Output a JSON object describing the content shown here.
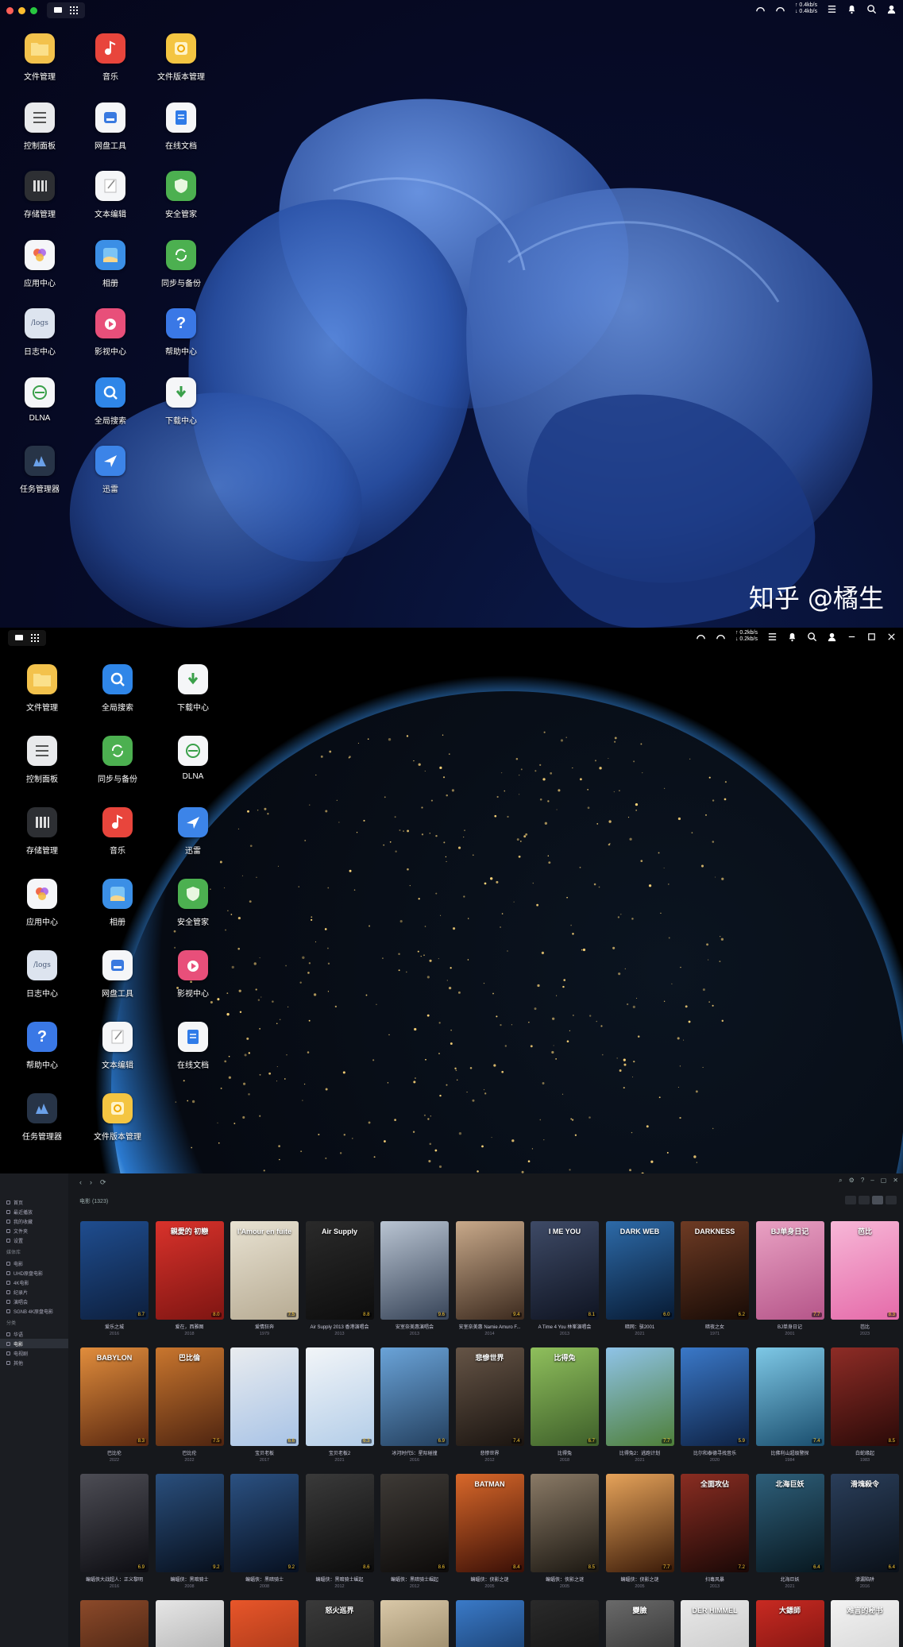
{
  "desktop1": {
    "speed": {
      "up": "↑ 0.4kb/s",
      "down": "↓ 0.4kb/s"
    },
    "apps": [
      {
        "label": "文件管理",
        "icon": "folder-icon",
        "color": "#f3c24c"
      },
      {
        "label": "音乐",
        "icon": "music-icon",
        "color": "#e8453c"
      },
      {
        "label": "文件版本管理",
        "icon": "version-icon",
        "color": "#f4c542"
      },
      {
        "label": "控制面板",
        "icon": "control-panel-icon",
        "color": "#e9eaec"
      },
      {
        "label": "网盘工具",
        "icon": "cloud-drive-icon",
        "color": "#f5f6f8"
      },
      {
        "label": "在线文档",
        "icon": "document-icon",
        "color": "#f5f6f8"
      },
      {
        "label": "存储管理",
        "icon": "storage-icon",
        "color": "#2d2f33"
      },
      {
        "label": "文本编辑",
        "icon": "text-edit-icon",
        "color": "#f5f6f8"
      },
      {
        "label": "安全管家",
        "icon": "shield-icon",
        "color": "#4cb050"
      },
      {
        "label": "应用中心",
        "icon": "app-center-icon",
        "color": "#f5f6f8"
      },
      {
        "label": "相册",
        "icon": "photos-icon",
        "color": "#3b8fe6"
      },
      {
        "label": "同步与备份",
        "icon": "sync-icon",
        "color": "#4cb050"
      },
      {
        "label": "日志中心",
        "icon": "logs-icon",
        "color": "#dde4ef",
        "text": "/logs"
      },
      {
        "label": "影视中心",
        "icon": "video-icon",
        "color": "#e84f7a"
      },
      {
        "label": "帮助中心",
        "icon": "help-icon",
        "color": "#3a78e6"
      },
      {
        "label": "DLNA",
        "icon": "dlna-icon",
        "color": "#f5f6f8"
      },
      {
        "label": "全局搜索",
        "icon": "search-icon",
        "color": "#2f86e8"
      },
      {
        "label": "下载中心",
        "icon": "download-icon",
        "color": "#f5f6f8"
      },
      {
        "label": "任务管理器",
        "icon": "task-manager-icon",
        "color": "#273447"
      },
      {
        "label": "迅雷",
        "icon": "thunder-icon",
        "color": "#3c84e8"
      }
    ],
    "watermark": "知乎 @橘生"
  },
  "desktop2": {
    "speed": {
      "up": "↑ 0.2kb/s",
      "down": "↓ 0.2kb/s"
    },
    "apps": [
      {
        "label": "文件管理",
        "icon": "folder-icon",
        "color": "#f3c24c"
      },
      {
        "label": "全局搜索",
        "icon": "search-icon",
        "color": "#2f86e8"
      },
      {
        "label": "下载中心",
        "icon": "download-icon",
        "color": "#f5f6f8"
      },
      {
        "label": "控制面板",
        "icon": "control-panel-icon",
        "color": "#e9eaec"
      },
      {
        "label": "同步与备份",
        "icon": "sync-icon",
        "color": "#4cb050"
      },
      {
        "label": "DLNA",
        "icon": "dlna-icon",
        "color": "#f5f6f8"
      },
      {
        "label": "存储管理",
        "icon": "storage-icon",
        "color": "#2d2f33"
      },
      {
        "label": "音乐",
        "icon": "music-icon",
        "color": "#e8453c"
      },
      {
        "label": "迅雷",
        "icon": "thunder-icon",
        "color": "#3c84e8"
      },
      {
        "label": "应用中心",
        "icon": "app-center-icon",
        "color": "#f5f6f8"
      },
      {
        "label": "相册",
        "icon": "photos-icon",
        "color": "#3b8fe6"
      },
      {
        "label": "安全管家",
        "icon": "shield-icon",
        "color": "#4cb050"
      },
      {
        "label": "日志中心",
        "icon": "logs-icon",
        "color": "#dde4ef",
        "text": "/logs"
      },
      {
        "label": "网盘工具",
        "icon": "cloud-drive-icon",
        "color": "#f5f6f8"
      },
      {
        "label": "影视中心",
        "icon": "video-icon",
        "color": "#e84f7a"
      },
      {
        "label": "帮助中心",
        "icon": "help-icon",
        "color": "#3a78e6"
      },
      {
        "label": "文本编辑",
        "icon": "text-edit-icon",
        "color": "#f5f6f8"
      },
      {
        "label": "在线文档",
        "icon": "document-icon",
        "color": "#f5f6f8"
      },
      {
        "label": "任务管理器",
        "icon": "task-manager-icon",
        "color": "#273447"
      },
      {
        "label": "文件版本管理",
        "icon": "version-icon",
        "color": "#f4c542"
      }
    ]
  },
  "media": {
    "breadcrumb": "电影 (1323)",
    "sidebar": [
      {
        "type": "item",
        "label": "首页"
      },
      {
        "type": "item",
        "label": "最近播放"
      },
      {
        "type": "item",
        "label": "我的收藏"
      },
      {
        "type": "item",
        "label": "文件夹"
      },
      {
        "type": "item",
        "label": "设置"
      },
      {
        "type": "sec",
        "label": "媒体库"
      },
      {
        "type": "item",
        "label": "电影"
      },
      {
        "type": "item",
        "label": "UHD原盘电影"
      },
      {
        "type": "item",
        "label": "4K电影"
      },
      {
        "type": "item",
        "label": "纪录片"
      },
      {
        "type": "item",
        "label": "演唱会"
      },
      {
        "type": "item",
        "label": "SGNB 4K原盘电影"
      },
      {
        "type": "sec",
        "label": "分类"
      },
      {
        "type": "item",
        "label": "华语"
      },
      {
        "type": "item",
        "label": "电影",
        "active": true
      },
      {
        "type": "item",
        "label": "电视剧"
      },
      {
        "type": "item",
        "label": "其他"
      }
    ],
    "posters": [
      [
        {
          "t": "爱乐之城",
          "y": "2016",
          "c1": "#1f4d8f",
          "c2": "#0d1f3d",
          "p": "",
          "r": "8.7"
        },
        {
          "t": "爱在，西雅图",
          "y": "2018",
          "c1": "#d9322b",
          "c2": "#7e1512",
          "p": "親愛的 初戀",
          "r": "8.0"
        },
        {
          "t": "爱情狂奔",
          "y": "1979",
          "c1": "#e8e2d2",
          "c2": "#b7ab93",
          "p": "l'Amour en fuite",
          "r": "7.5"
        },
        {
          "t": "Air Supply 2013 香港演唱会",
          "y": "2013",
          "c1": "#2a2a2a",
          "c2": "#0d0d0d",
          "p": "Air Supply",
          "r": "8.8"
        },
        {
          "t": "安室奈美惠演唱会",
          "y": "2013",
          "c1": "#b9c4d2",
          "c2": "#374458",
          "p": "",
          "r": "9.6"
        },
        {
          "t": "安室奈美惠 Namie Amuro F...",
          "y": "2014",
          "c1": "#c8a98a",
          "c2": "#3c2a1e",
          "p": "",
          "r": "9.4"
        },
        {
          "t": "A Time 4 You 林峯演唱会",
          "y": "2013",
          "c1": "#3e4a66",
          "c2": "#0f1422",
          "p": "I ME YOU",
          "r": "8.1"
        },
        {
          "t": "暗网：骇2001",
          "y": "2021",
          "c1": "#2d6aa8",
          "c2": "#071a33",
          "p": "DARK WEB",
          "r": "6.0"
        },
        {
          "t": "暗夜之女",
          "y": "1971",
          "c1": "#6e3b24",
          "c2": "#180b06",
          "p": "DARKNESS",
          "r": "6.2"
        },
        {
          "t": "BJ单身日记",
          "y": "2001",
          "c1": "#e9a1c3",
          "c2": "#b55589",
          "p": "BJ单身日记",
          "r": "7.7"
        },
        {
          "t": "芭比",
          "y": "2023",
          "c1": "#f7b7d7",
          "c2": "#e56aa9",
          "p": "芭比",
          "r": "8.3"
        }
      ],
      [
        {
          "t": "巴比伦",
          "y": "2022",
          "c1": "#e18d3c",
          "c2": "#5a2810",
          "p": "BABYLON",
          "r": "8.3"
        },
        {
          "t": "巴比伦",
          "y": "2022",
          "c1": "#c9762e",
          "c2": "#4e2410",
          "p": "巴比倫",
          "r": "7.5"
        },
        {
          "t": "宝贝老板",
          "y": "2017",
          "c1": "#e9ecef",
          "c2": "#a8c3e6",
          "p": "",
          "r": "6.6"
        },
        {
          "t": "宝贝老板2",
          "y": "2021",
          "c1": "#f2f5f8",
          "c2": "#b3cde8",
          "p": "",
          "r": "6.3"
        },
        {
          "t": "冰河时代5：星际碰撞",
          "y": "2016",
          "c1": "#6aa3d8",
          "c2": "#24405f",
          "p": "",
          "r": "6.9"
        },
        {
          "t": "悲惨世界",
          "y": "2012",
          "c1": "#655446",
          "c2": "#1a1410",
          "p": "悲慘世界",
          "r": "7.4"
        },
        {
          "t": "比得兔",
          "y": "2018",
          "c1": "#8fbf5c",
          "c2": "#3e5f2a",
          "p": "比得兔",
          "r": "6.7"
        },
        {
          "t": "比得兔2：逃跑计划",
          "y": "2021",
          "c1": "#8fc3e8",
          "c2": "#4e7f38",
          "p": "",
          "r": "7.7"
        },
        {
          "t": "比尔和泰德寻找音乐",
          "y": "2020",
          "c1": "#3a78c8",
          "c2": "#0e2244",
          "p": "",
          "r": "5.9"
        },
        {
          "t": "比佛利山超级警探",
          "y": "1984",
          "c1": "#7ec8e6",
          "c2": "#1a4e6e",
          "p": "",
          "r": "7.4"
        },
        {
          "t": "白蛇缘起",
          "y": "1983",
          "c1": "#8e2c26",
          "c2": "#2a0a08",
          "p": "",
          "r": "8.5"
        }
      ],
      [
        {
          "t": "蝙蝠侠大战超人：正义黎明",
          "y": "2016",
          "c1": "#4d4d55",
          "c2": "#0d0d12",
          "p": "",
          "r": "6.9"
        },
        {
          "t": "蝙蝠侠：黑暗骑士",
          "y": "2008",
          "c1": "#2a4f7d",
          "c2": "#070f1c",
          "p": "",
          "r": "9.2"
        },
        {
          "t": "蝙蝠侠：黑暗骑士",
          "y": "2008",
          "c1": "#2b5182",
          "c2": "#071020",
          "p": "",
          "r": "9.2"
        },
        {
          "t": "蝙蝠侠：黑暗骑士崛起",
          "y": "2012",
          "c1": "#3a3a3a",
          "c2": "#0c0c0c",
          "p": "",
          "r": "8.6"
        },
        {
          "t": "蝙蝠侠：黑暗骑士崛起",
          "y": "2012",
          "c1": "#3e3a36",
          "c2": "#0d0b0a",
          "p": "",
          "r": "8.6"
        },
        {
          "t": "蝙蝠侠：侠影之谜",
          "y": "2005",
          "c1": "#d9682a",
          "c2": "#3a0f06",
          "p": "BATMAN",
          "r": "8.4"
        },
        {
          "t": "蝙蝠侠：侠影之谜",
          "y": "2005",
          "c1": "#8a7a66",
          "c2": "#1c1812",
          "p": "",
          "r": "8.5"
        },
        {
          "t": "蝙蝠侠：侠影之谜",
          "y": "2005",
          "c1": "#e6a35a",
          "c2": "#3a1a08",
          "p": "",
          "r": "7.7"
        },
        {
          "t": "扫毒风暴",
          "y": "2013",
          "c1": "#8a2d22",
          "c2": "#1a0806",
          "p": "全面攻佔",
          "r": "7.2"
        },
        {
          "t": "北海巨妖",
          "y": "2021",
          "c1": "#2e5f7a",
          "c2": "#081820",
          "p": "北海巨妖",
          "r": "6.4"
        },
        {
          "t": "渗漏陷阱",
          "y": "2016",
          "c1": "#2a3e5a",
          "c2": "#0a1018",
          "p": "滑塊殺令",
          "r": "6.4"
        }
      ],
      [
        {
          "t": "",
          "y": "",
          "c1": "#8c4a2a",
          "c2": "#2a1208",
          "p": "",
          "r": ""
        },
        {
          "t": "",
          "y": "",
          "c1": "#e6e6e6",
          "c2": "#9a9a9a",
          "p": "",
          "r": ""
        },
        {
          "t": "",
          "y": "",
          "c1": "#e8562a",
          "c2": "#8a2a10",
          "p": "",
          "r": ""
        },
        {
          "t": "",
          "y": "",
          "c1": "#3a3a3a",
          "c2": "#151515",
          "p": "怒火巡界",
          "r": ""
        },
        {
          "t": "",
          "y": "",
          "c1": "#d9c8a8",
          "c2": "#7a6a4a",
          "p": "",
          "r": ""
        },
        {
          "t": "",
          "y": "",
          "c1": "#3a7ac8",
          "c2": "#0a2244",
          "p": "",
          "r": ""
        },
        {
          "t": "",
          "y": "",
          "c1": "#2a2a2a",
          "c2": "#0a0a0a",
          "p": "",
          "r": ""
        },
        {
          "t": "",
          "y": "",
          "c1": "#6a6a6a",
          "c2": "#1a1a1a",
          "p": "變臉",
          "r": ""
        },
        {
          "t": "",
          "y": "",
          "c1": "#e8e8e8",
          "c2": "#bcbcbc",
          "p": "DER HIMMEL",
          "r": ""
        },
        {
          "t": "",
          "y": "",
          "c1": "#c82a22",
          "c2": "#5a0a08",
          "p": "大鏢師",
          "r": ""
        },
        {
          "t": "",
          "y": "",
          "c1": "#f2f2f2",
          "c2": "#c8c8c8",
          "p": "难言的秘书",
          "r": ""
        }
      ]
    ]
  }
}
